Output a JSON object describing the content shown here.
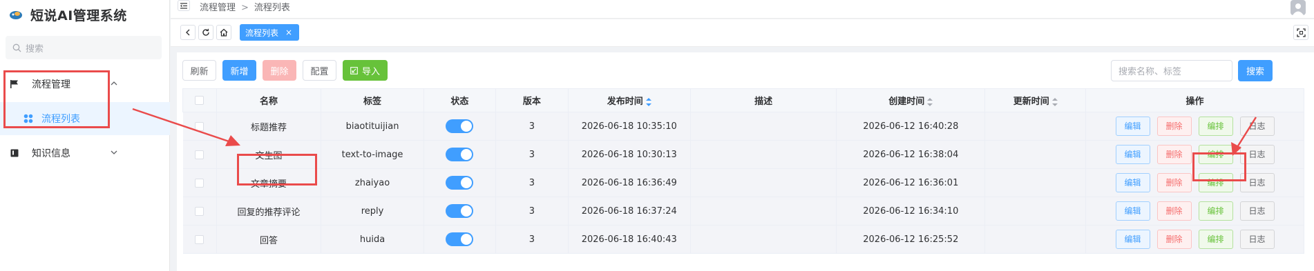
{
  "app": {
    "title": "短说AI管理系统",
    "accent_color": "#409eff"
  },
  "sidebar": {
    "search_placeholder": "搜索",
    "menu": [
      {
        "label": "流程管理",
        "icon": "flag-icon",
        "expanded": true,
        "children": [
          {
            "label": "流程列表",
            "icon": "apps-icon",
            "active": true
          }
        ]
      },
      {
        "label": "知识信息",
        "icon": "book-icon",
        "expanded": false
      }
    ]
  },
  "header": {
    "breadcrumb": [
      "流程管理",
      "流程列表"
    ]
  },
  "tabs": {
    "active": {
      "label": "流程列表",
      "close": "×"
    }
  },
  "toolbar": {
    "refresh": "刷新",
    "add": "新增",
    "delete": "删除",
    "config": "配置",
    "import": "导入",
    "search_placeholder": "搜索名称、标签",
    "search": "搜索"
  },
  "table": {
    "columns": [
      "名称",
      "标签",
      "状态",
      "版本",
      "发布时间",
      "描述",
      "创建时间",
      "更新时间",
      "操作"
    ],
    "rows": [
      {
        "name": "标题推荐",
        "tag": "biaotituijian",
        "enabled": true,
        "version": "3",
        "published": "2026-06-18 10:35:10",
        "desc": "",
        "created": "2026-06-12 16:40:28",
        "updated": ""
      },
      {
        "name": "文生图",
        "tag": "text-to-image",
        "enabled": true,
        "version": "3",
        "published": "2026-06-18 10:30:13",
        "desc": "",
        "created": "2026-06-12 16:38:04",
        "updated": ""
      },
      {
        "name": "文章摘要",
        "tag": "zhaiyao",
        "enabled": true,
        "version": "3",
        "published": "2026-06-18 16:36:49",
        "desc": "",
        "created": "2026-06-12 16:36:01",
        "updated": ""
      },
      {
        "name": "回复的推荐评论",
        "tag": "reply",
        "enabled": true,
        "version": "3",
        "published": "2026-06-18 16:37:24",
        "desc": "",
        "created": "2026-06-12 16:34:10",
        "updated": ""
      },
      {
        "name": "回答",
        "tag": "huida",
        "enabled": true,
        "version": "3",
        "published": "2026-06-18 16:40:43",
        "desc": "",
        "created": "2026-06-12 16:25:52",
        "updated": ""
      }
    ],
    "actions": {
      "edit": "编辑",
      "delete": "删除",
      "arrange": "编排",
      "log": "日志"
    }
  }
}
